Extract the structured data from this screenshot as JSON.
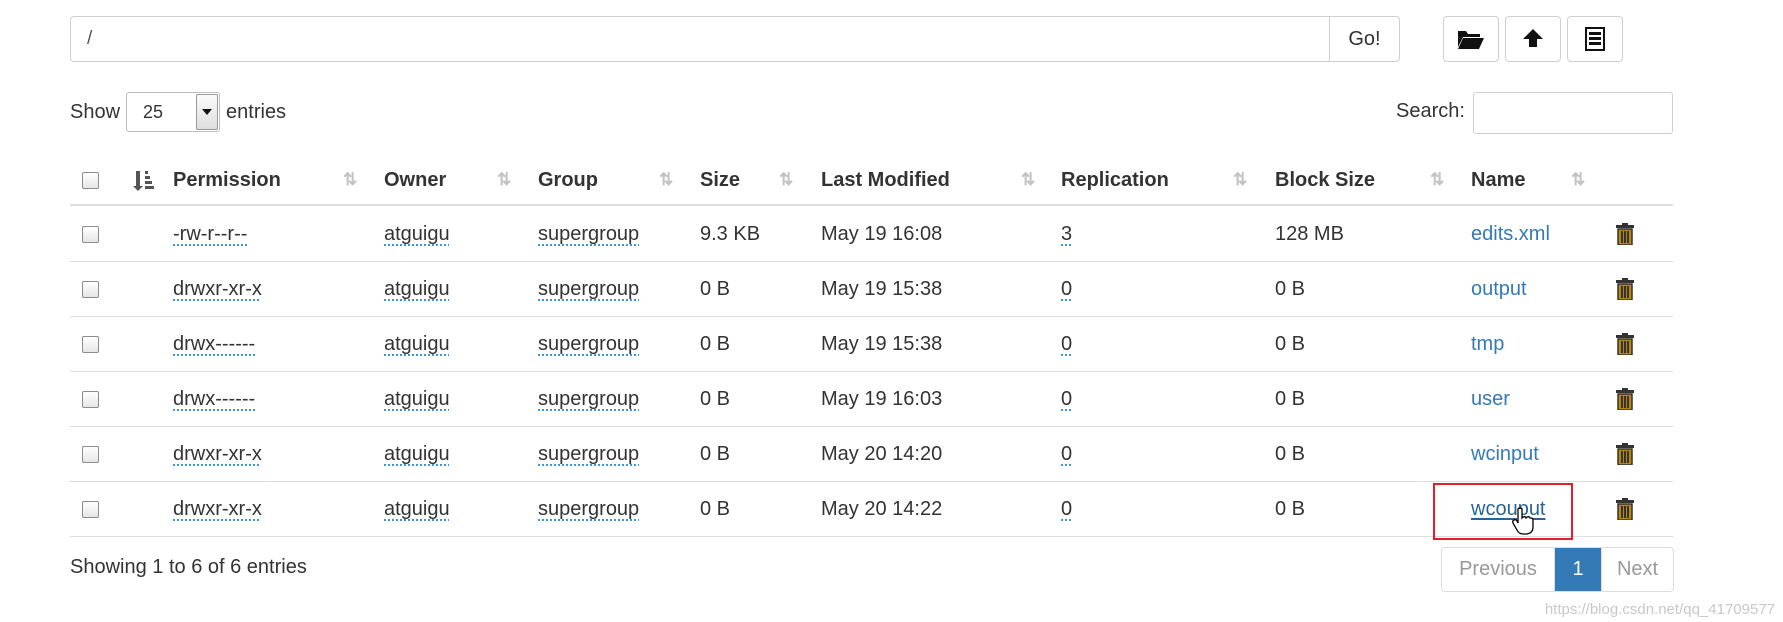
{
  "toolbar": {
    "path_value": "/",
    "go_label": "Go!",
    "buttons": [
      "folder-open-icon",
      "upload-icon",
      "list-icon"
    ]
  },
  "length_menu": {
    "show_label": "Show",
    "value": "25",
    "entries_label": "entries"
  },
  "search": {
    "label": "Search:",
    "value": ""
  },
  "table": {
    "columns": [
      "Permission",
      "Owner",
      "Group",
      "Size",
      "Last Modified",
      "Replication",
      "Block Size",
      "Name"
    ],
    "rows": [
      {
        "permission": "-rw-r--r--",
        "owner": "atguigu",
        "group": "supergroup",
        "size": "9.3 KB",
        "last_modified": "May 19 16:08",
        "replication": "3",
        "block_size": "128 MB",
        "name": "edits.xml"
      },
      {
        "permission": "drwxr-xr-x",
        "owner": "atguigu",
        "group": "supergroup",
        "size": "0 B",
        "last_modified": "May 19 15:38",
        "replication": "0",
        "block_size": "0 B",
        "name": "output"
      },
      {
        "permission": "drwx------",
        "owner": "atguigu",
        "group": "supergroup",
        "size": "0 B",
        "last_modified": "May 19 15:38",
        "replication": "0",
        "block_size": "0 B",
        "name": "tmp"
      },
      {
        "permission": "drwx------",
        "owner": "atguigu",
        "group": "supergroup",
        "size": "0 B",
        "last_modified": "May 19 16:03",
        "replication": "0",
        "block_size": "0 B",
        "name": "user"
      },
      {
        "permission": "drwxr-xr-x",
        "owner": "atguigu",
        "group": "supergroup",
        "size": "0 B",
        "last_modified": "May 20 14:20",
        "replication": "0",
        "block_size": "0 B",
        "name": "wcinput"
      },
      {
        "permission": "drwxr-xr-x",
        "owner": "atguigu",
        "group": "supergroup",
        "size": "0 B",
        "last_modified": "May 20 14:22",
        "replication": "0",
        "block_size": "0 B",
        "name": "wcouput"
      }
    ]
  },
  "footer": {
    "info": "Showing 1 to 6 of 6 entries",
    "previous": "Previous",
    "page": "1",
    "next": "Next"
  },
  "watermark": "https://blog.csdn.net/qq_41709577",
  "colors": {
    "link": "#337ab7",
    "active_page": "#337ab7",
    "highlight": "#e0202a",
    "trash": "#b8860b"
  }
}
